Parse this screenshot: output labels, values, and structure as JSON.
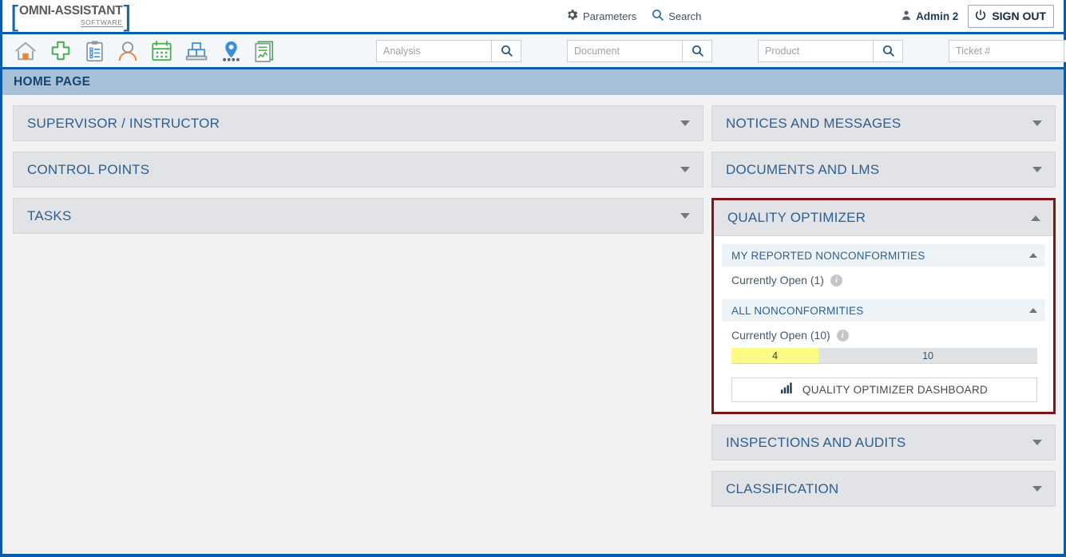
{
  "brand": {
    "name": "OMNI-ASSISTANT",
    "tagline": "SOFTWARE"
  },
  "header": {
    "parameters_label": "Parameters",
    "search_label": "Search",
    "user_name": "Admin 2",
    "sign_out_label": "SIGN OUT",
    "icons": {
      "gear": "gear-icon",
      "search": "search-icon",
      "user": "user-icon",
      "power": "power-icon"
    }
  },
  "toolbar": {
    "icons": [
      {
        "name": "home-icon",
        "label": "Home"
      },
      {
        "name": "add-cross-icon",
        "label": "New"
      },
      {
        "name": "clipboard-checklist-icon",
        "label": "Checklist"
      },
      {
        "name": "person-icon",
        "label": "Person"
      },
      {
        "name": "calendar-icon",
        "label": "Calendar"
      },
      {
        "name": "pallet-inventory-icon",
        "label": "Inventory"
      },
      {
        "name": "location-pin-icon",
        "label": "Location"
      },
      {
        "name": "report-chart-icon",
        "label": "Reports"
      }
    ],
    "searches": [
      {
        "name": "analysis-search",
        "placeholder": "Analysis",
        "value": ""
      },
      {
        "name": "document-search",
        "placeholder": "Document",
        "value": ""
      },
      {
        "name": "product-search",
        "placeholder": "Product",
        "value": ""
      },
      {
        "name": "ticket-search",
        "placeholder": "Ticket #",
        "value": ""
      }
    ]
  },
  "page": {
    "title": "HOME PAGE"
  },
  "left_panels": [
    {
      "label": "SUPERVISOR / INSTRUCTOR",
      "expanded": false
    },
    {
      "label": "CONTROL POINTS",
      "expanded": false
    },
    {
      "label": "TASKS",
      "expanded": false
    }
  ],
  "right_panels_top": [
    {
      "label": "NOTICES AND MESSAGES",
      "expanded": false
    },
    {
      "label": "DOCUMENTS AND LMS",
      "expanded": false
    }
  ],
  "quality_optimizer": {
    "title": "QUALITY OPTIMIZER",
    "expanded": true,
    "highlight_color": "#7d1616",
    "sections": [
      {
        "title": "MY REPORTED NONCONFORMITIES",
        "expanded": true,
        "row_label": "Currently Open (1)",
        "has_bar": false
      },
      {
        "title": "ALL NONCONFORMITIES",
        "expanded": true,
        "row_label": "Currently Open (10)",
        "has_bar": true,
        "bar": {
          "fill_value": "4",
          "total_value": "10",
          "fill_percent": 28.5,
          "fill_color": "#fcfb86",
          "track_color": "#e0e3e6"
        }
      }
    ],
    "dashboard_button": {
      "label": "QUALITY OPTIMIZER DASHBOARD",
      "icon": "bar-chart-icon"
    }
  },
  "right_panels_bottom": [
    {
      "label": "INSPECTIONS AND AUDITS",
      "expanded": false
    },
    {
      "label": "CLASSIFICATION",
      "expanded": false
    }
  ],
  "colors": {
    "frame_blue": "#0a5ba8",
    "title_bar": "#a7c0d8",
    "panel_head": "#e1e3e6",
    "panel_title_text": "#2e5f8e",
    "highlight_red": "#7d1616"
  }
}
